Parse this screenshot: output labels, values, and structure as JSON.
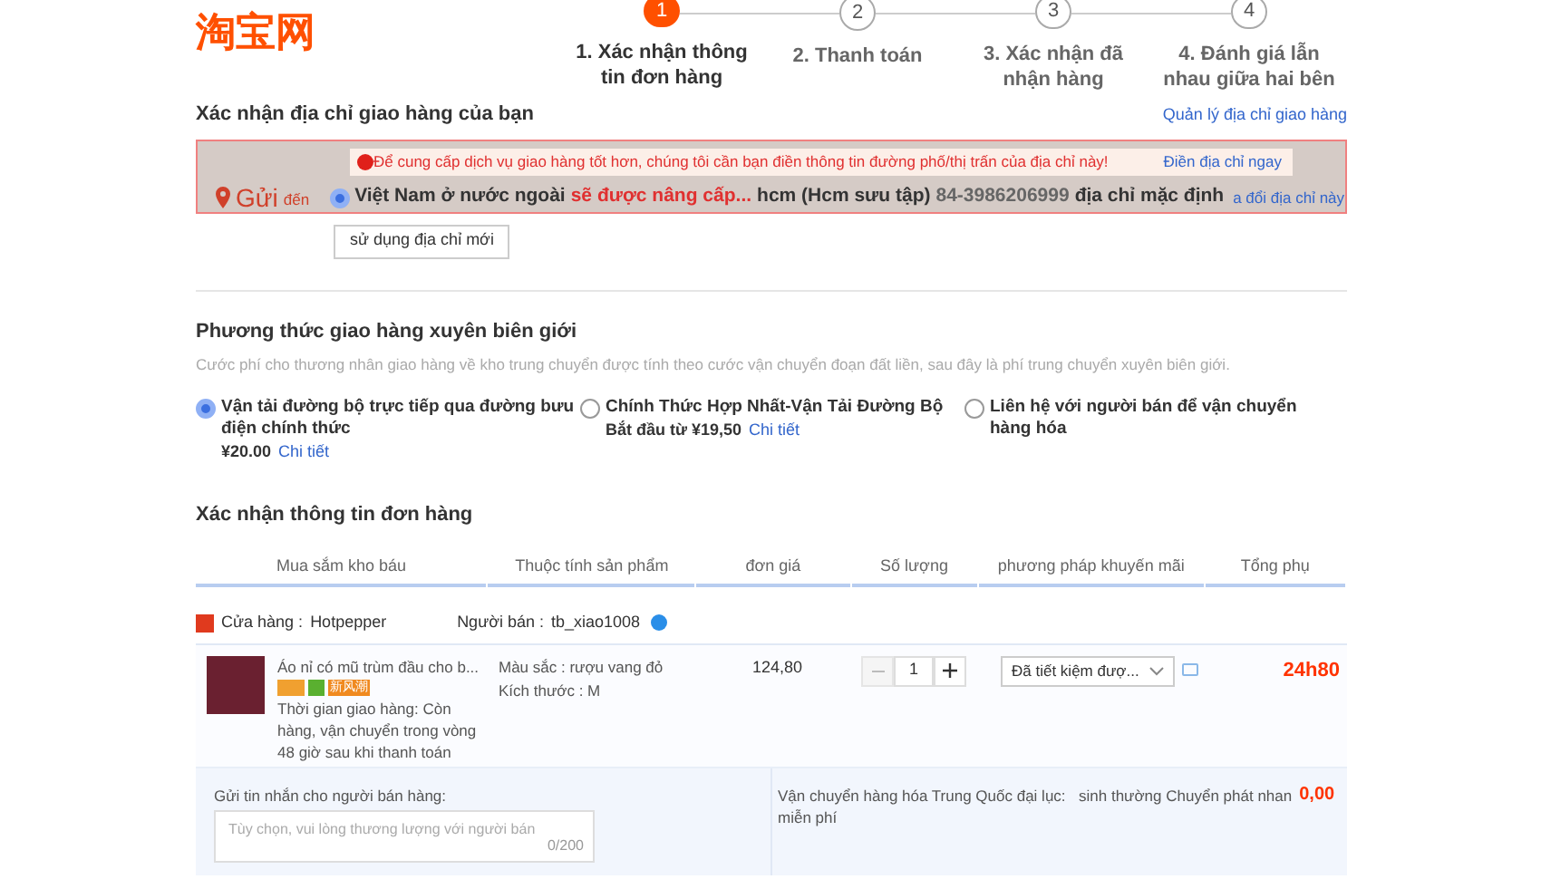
{
  "logo": "淘宝网",
  "steps": [
    {
      "number": "1",
      "label": "1. Xác nhận thông tin đơn hàng",
      "selected": true
    },
    {
      "number": "2",
      "label": "2. Thanh toán",
      "selected": false
    },
    {
      "number": "3",
      "label": "3. Xác nhận đã nhận hàng",
      "selected": false
    },
    {
      "number": "4",
      "label": "4. Đánh giá lẫn nhau giữa hai bên",
      "selected": false
    }
  ],
  "address": {
    "title": "Xác nhận địa chỉ giao hàng của bạn",
    "manage_link": "Quản lý địa chỉ giao hàng",
    "notice": "Để cung cấp dịch vụ giao hàng tốt hơn, chúng tôi cần bạn điền thông tin đường phố/thị trấn của địa chỉ này!",
    "notice_link": "Điền địa chỉ ngay",
    "send_label": "Gửi",
    "send_suffix": "đến",
    "selected": true,
    "country": "Việt Nam ở nước ngoài",
    "upgrade": "sẽ được nâng cấp...",
    "recipient": "hcm (Hcm sưu tập)",
    "phone": "84-3986206999",
    "default": "địa chỉ mặc định",
    "edit_link": "a đổi địa chỉ này",
    "new_button": "sử dụng địa chỉ mới"
  },
  "shipping": {
    "title": "Phương thức giao hàng xuyên biên giới",
    "description": "Cước phí cho thương nhân giao hàng về kho trung chuyển được tính theo cước vận chuyển đoạn đất liền, sau đây là phí trung chuyển xuyên biên giới.",
    "options": [
      {
        "label": "Vận tải đường bộ trực tiếp qua đường bưu điện chính thức",
        "price": "¥20.00",
        "link": "Chi tiết",
        "selected": true
      },
      {
        "label": "Chính Thức Hợp Nhất-Vận Tải Đường Bộ",
        "price": "Bắt đầu từ ¥19,50",
        "link": "Chi tiết",
        "selected": false
      },
      {
        "label": "Liên hệ với người bán để vận chuyển hàng hóa",
        "selected": false
      }
    ]
  },
  "order": {
    "title": "Xác nhận thông tin đơn hàng",
    "columns": [
      "Mua sắm kho báu",
      "Thuộc tính sản phẩm",
      "đơn giá",
      "Số lượng",
      "phương pháp khuyến mãi",
      "Tổng phụ"
    ],
    "shop_label": "Cửa hàng :",
    "shop": "Hotpepper",
    "seller_label": "Người bán :",
    "seller": "tb_xiao1008",
    "item": {
      "name": "Áo nỉ có mũ trùm đầu cho b...",
      "badge": "新风潮",
      "delivery": "Thời gian giao hàng: Còn hàng, vận chuyển trong vòng 48 giờ sau khi thanh toán",
      "colour_attribute": "Màu sắc : rượu vang đỏ",
      "size": "Kích thước : M",
      "price": "124,80",
      "quantity": "1",
      "promotion": "Đã tiết kiệm đượ...",
      "subtotal": "24h80"
    },
    "message": {
      "label": "Gửi tin nhắn cho người bán hàng:",
      "placeholder": "Tùy chọn, vui lòng thương lượng với người bán",
      "counter": "0/200"
    },
    "domestic": {
      "label": "Vận chuyển hàng hóa Trung Quốc đại lục: miễn phí",
      "method": "sinh thường Chuyển phát nhan",
      "cost": "0,00"
    }
  }
}
